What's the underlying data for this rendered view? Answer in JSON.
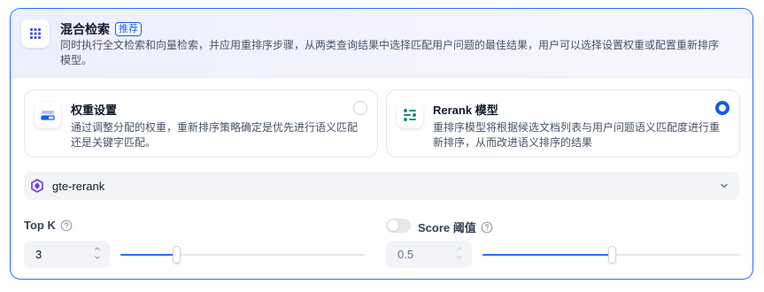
{
  "header": {
    "title": "混合检索",
    "badge": "推荐",
    "description": "同时执行全文检索和向量检索，并应用重排序步骤，从两类查询结果中选择匹配用户问题的最佳结果，用户可以选择设置权重或配置重新排序模型。",
    "icon": "grid-dots-icon"
  },
  "modes": [
    {
      "title": "权重设置",
      "description": "通过调整分配的权重，重新排序策略确定是优先进行语义匹配还是关键字匹配。",
      "selected": false,
      "icon": "weight-settings-icon"
    },
    {
      "title": "Rerank 模型",
      "description": "重排序模型将根据候选文档列表与用户问题语义匹配度进行重新排序，从而改进语义排序的结果",
      "selected": true,
      "icon": "rerank-sliders-icon"
    }
  ],
  "model": {
    "name": "gte-rerank",
    "icon": "model-logo-icon"
  },
  "top_k": {
    "label": "Top K",
    "value": "3",
    "slider_fraction": 0.23
  },
  "score_threshold": {
    "label": "Score 阈值",
    "enabled": false,
    "value": "0.5",
    "slider_fraction": 0.5
  },
  "colors": {
    "accent": "#155aef",
    "border_active": "#296dff",
    "header_bg": "#eef0ff"
  }
}
